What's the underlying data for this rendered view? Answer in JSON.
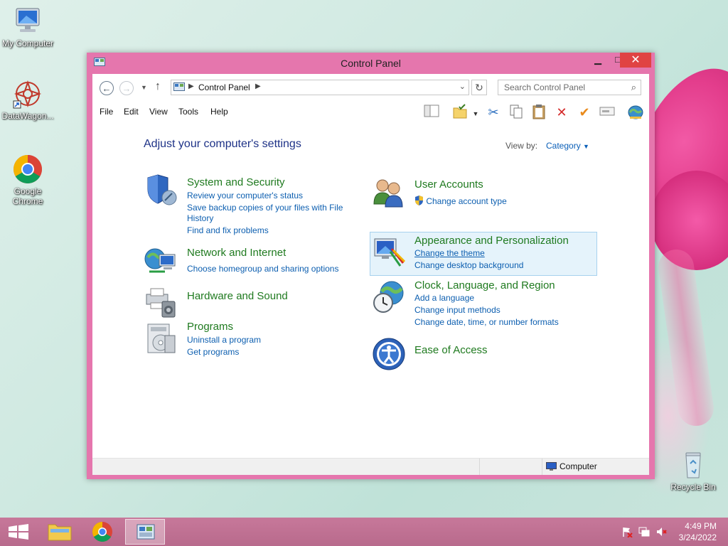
{
  "desktop": {
    "icons": [
      {
        "label": "My Computer"
      },
      {
        "label": "DataWagon..."
      },
      {
        "label": "Google Chrome"
      },
      {
        "label": "Recycle Bin"
      }
    ]
  },
  "window": {
    "title": "Control Panel",
    "minimize": "▭",
    "maximize": "□",
    "close": "✕"
  },
  "address": {
    "path_item": "Control Panel",
    "search_placeholder": "Search Control Panel"
  },
  "menu": [
    "File",
    "Edit",
    "View",
    "Tools",
    "Help"
  ],
  "content": {
    "heading": "Adjust your computer's settings",
    "view_by_label": "View by:",
    "view_by_value": "Category",
    "categories": [
      {
        "title": "System and Security",
        "links": [
          "Review your computer's status",
          "Save backup copies of your files with File",
          "History",
          "Find and fix problems"
        ]
      },
      {
        "title": "Network and Internet",
        "links": [
          "Choose homegroup and sharing options"
        ]
      },
      {
        "title": "Hardware and Sound",
        "links": []
      },
      {
        "title": "Programs",
        "links": [
          "Uninstall a program",
          "Get programs"
        ]
      },
      {
        "title": "User Accounts",
        "links": [
          "Change account type"
        ]
      },
      {
        "title": "Appearance and Personalization",
        "links": [
          "Change the theme",
          "Change desktop background"
        ]
      },
      {
        "title": "Clock, Language, and Region",
        "links": [
          "Add a language",
          "Change input methods",
          "Change date, time, or number formats"
        ]
      },
      {
        "title": "Ease of Access",
        "links": []
      }
    ]
  },
  "statusbar": {
    "location": "Computer"
  },
  "taskbar": {
    "time": "4:49 PM",
    "date": "3/24/2022"
  },
  "colors": {
    "window_frame": "#e576ad",
    "link": "#0d5fb0",
    "category_title": "#1f7a1f",
    "heading": "#1e3287",
    "close_button": "#e04343"
  }
}
